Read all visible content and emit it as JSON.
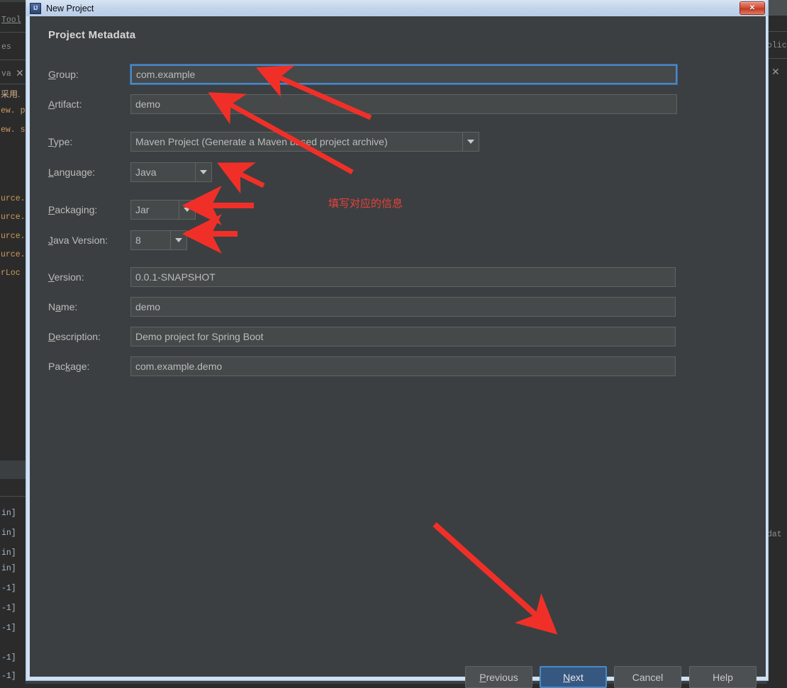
{
  "window": {
    "title": "New Project",
    "icon": "intellij-idea-icon",
    "close_icon": "close-icon"
  },
  "dialog": {
    "heading": "Project Metadata",
    "fields": [
      {
        "name": "group",
        "label_pre": "",
        "label_mnemonic": "G",
        "label_post": "roup:",
        "value": "com.example",
        "kind": "text",
        "focused": true
      },
      {
        "name": "artifact",
        "label_pre": "",
        "label_mnemonic": "A",
        "label_post": "rtifact:",
        "value": "demo",
        "kind": "text",
        "focused": false
      },
      {
        "name": "type",
        "label_pre": "",
        "label_mnemonic": "T",
        "label_post": "ype:",
        "value": "Maven Project (Generate a Maven based project archive)",
        "kind": "combo"
      },
      {
        "name": "language",
        "label_pre": "",
        "label_mnemonic": "L",
        "label_post": "anguage:",
        "value": "Java",
        "kind": "combo"
      },
      {
        "name": "packaging",
        "label_pre": "",
        "label_mnemonic": "P",
        "label_post": "ackaging:",
        "value": "Jar",
        "kind": "combo"
      },
      {
        "name": "java-version",
        "label_pre": "",
        "label_mnemonic": "J",
        "label_post": "ava Version:",
        "value": "8",
        "kind": "combo"
      },
      {
        "name": "version",
        "label_pre": "",
        "label_mnemonic": "V",
        "label_post": "ersion:",
        "value": "0.0.1-SNAPSHOT",
        "kind": "text",
        "focused": false
      },
      {
        "name": "name",
        "label_pre": "N",
        "label_mnemonic": "a",
        "label_post": "me:",
        "value": "demo",
        "kind": "text",
        "focused": false
      },
      {
        "name": "description",
        "label_pre": "",
        "label_mnemonic": "D",
        "label_post": "escription:",
        "value": "Demo project for Spring Boot",
        "kind": "text",
        "focused": false
      },
      {
        "name": "package",
        "label_pre": "Pac",
        "label_mnemonic": "k",
        "label_post": "age:",
        "value": "com.example.demo",
        "kind": "text",
        "focused": false
      }
    ],
    "buttons": [
      {
        "name": "previous",
        "pre": "",
        "mnemonic": "P",
        "post": "revious",
        "primary": false
      },
      {
        "name": "next",
        "pre": "",
        "mnemonic": "N",
        "post": "ext",
        "primary": true
      },
      {
        "name": "cancel",
        "pre": "C",
        "mnemonic": "",
        "post": "ancel",
        "primary": false
      },
      {
        "name": "help",
        "pre": "H",
        "mnemonic": "",
        "post": "elp",
        "primary": false
      }
    ]
  },
  "annotations": {
    "note_text": "填写对应的信息",
    "note_color": "#e8413a",
    "arrow_color": "#f03028"
  },
  "background": {
    "left_lines": [
      "Tool",
      "es",
      "va",
      "采用.",
      "ew. p",
      "ew. s",
      "urce.",
      "urce.",
      "urce.",
      "urce.",
      "rLoc",
      "in]",
      "in]",
      "in]",
      "in]",
      "-1]",
      "-1]",
      "-1]",
      "-1]",
      "-1]"
    ],
    "right_lines": [
      "olic",
      "dat"
    ]
  }
}
